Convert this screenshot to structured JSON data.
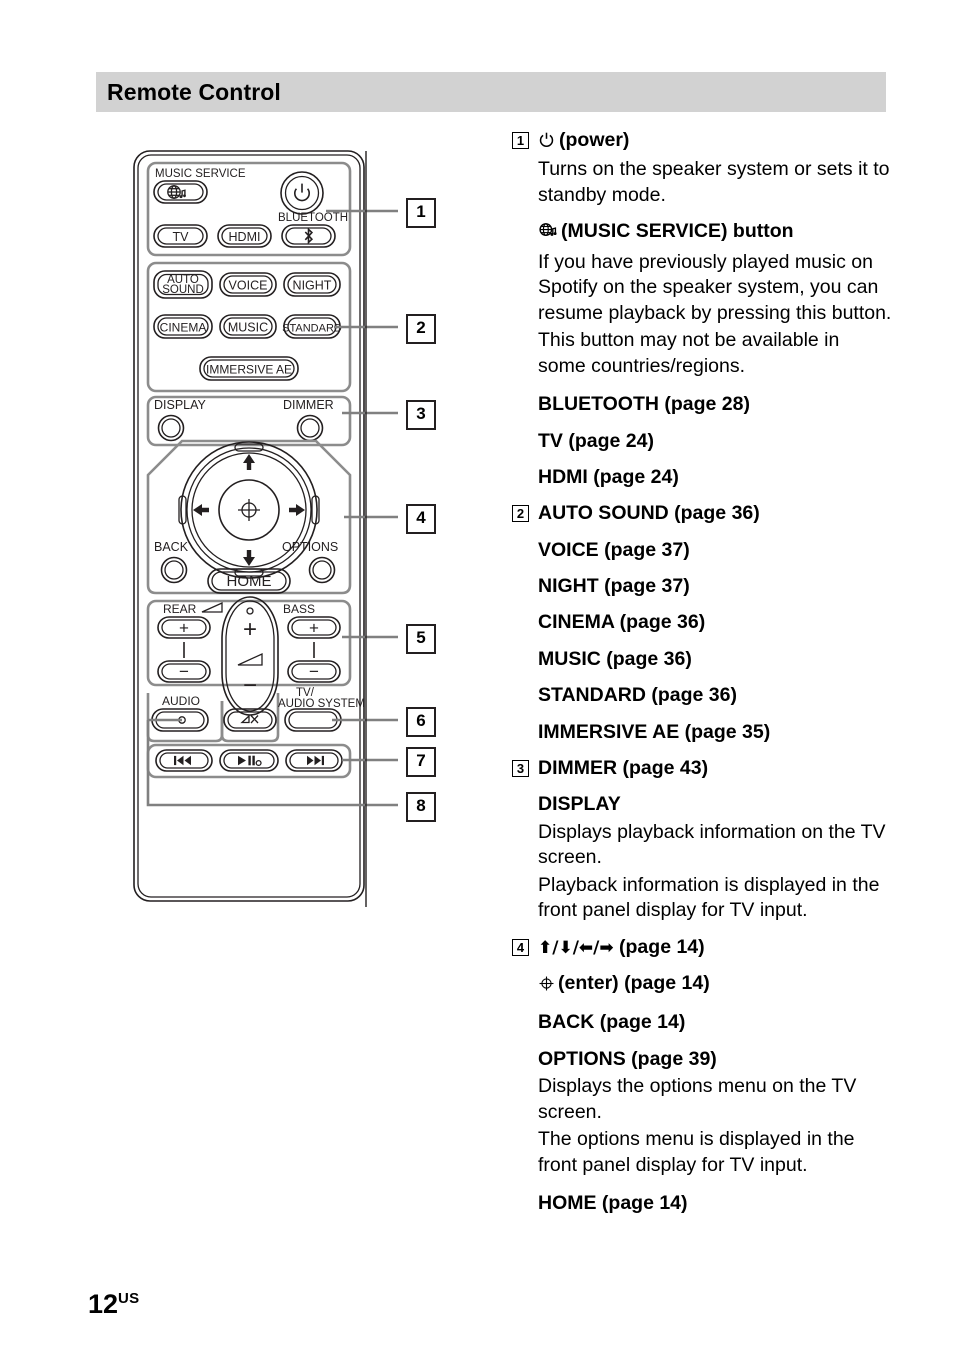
{
  "header": {
    "title": "Remote Control"
  },
  "footer": {
    "page_number": "12",
    "region_suffix": "US"
  },
  "remote_diagram": {
    "labels": {
      "music_service": "MUSIC SERVICE",
      "bluetooth": "BLUETOOTH",
      "tv": "TV",
      "hdmi": "HDMI",
      "auto_sound_line1": "AUTO",
      "auto_sound_line2": "SOUND",
      "voice": "VOICE",
      "night": "NIGHT",
      "cinema": "CINEMA",
      "music": "MUSIC",
      "standard": "STANDARD",
      "immersive_ae": "IMMERSIVE AE",
      "display": "DISPLAY",
      "dimmer": "DIMMER",
      "back": "BACK",
      "options": "OPTIONS",
      "home": "HOME",
      "rear": "REAR",
      "bass": "BASS",
      "audio": "AUDIO",
      "tv_audio_system_line1": "TV/",
      "tv_audio_system_line2": "AUDIO SYSTEM",
      "plus": "+",
      "minus": "−"
    },
    "callouts": [
      "1",
      "2",
      "3",
      "4",
      "5",
      "6",
      "7",
      "8"
    ]
  },
  "descriptions": [
    {
      "callout": "1",
      "blocks": [
        {
          "type": "heading",
          "icon": "power-icon",
          "text": "(power)"
        },
        {
          "type": "paragraph",
          "text": "Turns on the speaker system or sets it to standby mode."
        },
        {
          "type": "heading",
          "icon": "music-service-icon",
          "text": "(MUSIC SERVICE) button"
        },
        {
          "type": "paragraph",
          "text": "If you have previously played music on Spotify on the speaker system, you can resume playback by pressing this button."
        },
        {
          "type": "paragraph",
          "text": "This button may not be available in some countries/regions."
        },
        {
          "type": "heading",
          "text": "BLUETOOTH (page 28)"
        },
        {
          "type": "heading",
          "text": "TV (page 24)"
        },
        {
          "type": "heading",
          "text": "HDMI (page 24)"
        }
      ]
    },
    {
      "callout": "2",
      "blocks": [
        {
          "type": "heading",
          "text": "AUTO SOUND (page 36)"
        },
        {
          "type": "heading",
          "text": "VOICE (page 37)"
        },
        {
          "type": "heading",
          "text": "NIGHT (page 37)"
        },
        {
          "type": "heading",
          "text": "CINEMA (page 36)"
        },
        {
          "type": "heading",
          "text": "MUSIC (page 36)"
        },
        {
          "type": "heading",
          "text": "STANDARD (page 36)"
        },
        {
          "type": "heading",
          "text": "IMMERSIVE AE (page 35)"
        }
      ]
    },
    {
      "callout": "3",
      "blocks": [
        {
          "type": "heading",
          "text": "DIMMER (page 43)"
        },
        {
          "type": "heading",
          "text": "DISPLAY"
        },
        {
          "type": "paragraph",
          "text": "Displays playback information on the TV screen."
        },
        {
          "type": "paragraph",
          "text": "Playback information is displayed in the front panel display for TV input."
        }
      ]
    },
    {
      "callout": "4",
      "blocks": [
        {
          "type": "heading",
          "arrows": "⬆/⬇/⬅/➡",
          "text": "(page 14)"
        },
        {
          "type": "heading",
          "icon": "enter-icon",
          "text": "(enter) (page 14)"
        },
        {
          "type": "heading",
          "text": "BACK (page 14)"
        },
        {
          "type": "heading",
          "text": "OPTIONS (page 39)"
        },
        {
          "type": "paragraph",
          "text": "Displays the options menu on the TV screen."
        },
        {
          "type": "paragraph",
          "text": "The options menu is displayed in the front panel display for TV input."
        },
        {
          "type": "heading",
          "text": "HOME (page 14)"
        }
      ]
    }
  ],
  "colors": {
    "header_band": "#d2d2d2",
    "text": "#000000",
    "callout_line": "#808080",
    "diagram_stroke": "#231f20"
  }
}
